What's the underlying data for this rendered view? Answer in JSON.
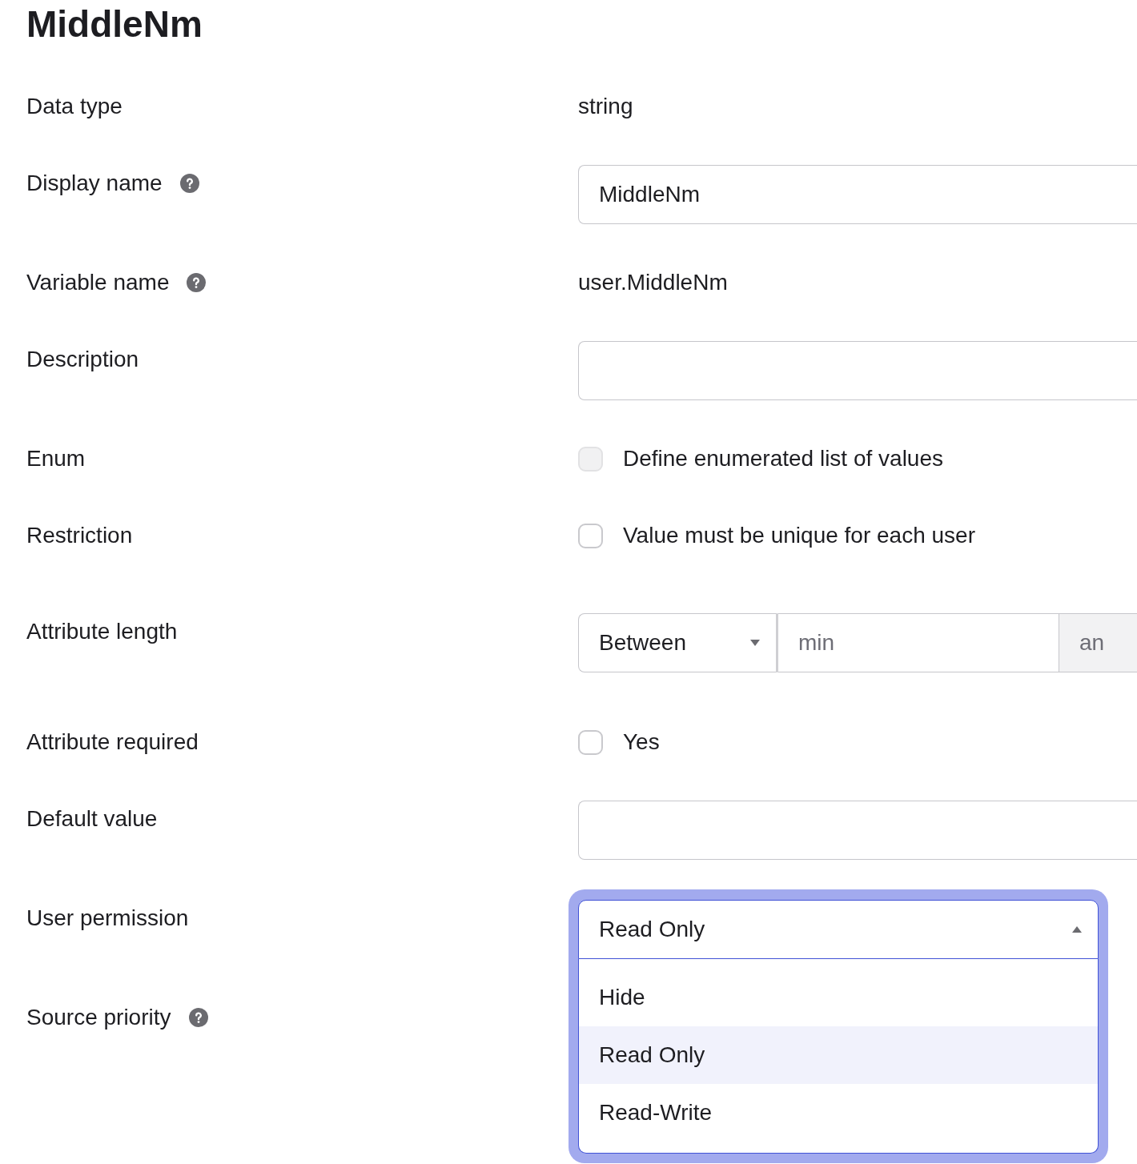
{
  "title": "MiddleNm",
  "fields": [
    {
      "kind": "text",
      "label": "Data type",
      "value": "string"
    },
    {
      "kind": "input",
      "label": "Display name",
      "help": true,
      "value": "MiddleNm"
    },
    {
      "kind": "text",
      "label": "Variable name",
      "help": true,
      "value": "user.MiddleNm"
    },
    {
      "kind": "input",
      "label": "Description"
    },
    {
      "kind": "checkbox",
      "label": "Enum",
      "checked": false,
      "disabled": true,
      "option": "Define enumerated list of values"
    },
    {
      "kind": "checkbox",
      "label": "Restriction",
      "checked": false,
      "disabled": false,
      "option": "Value must be unique for each user"
    },
    {
      "kind": "range",
      "label": "Attribute length",
      "select": {
        "value": "Between"
      },
      "min_placeholder": "min",
      "addon": "an"
    },
    {
      "kind": "checkbox",
      "label": "Attribute required",
      "checked": false,
      "disabled": false,
      "option": "Yes"
    },
    {
      "kind": "input",
      "label": "Default value"
    },
    {
      "kind": "dropdown",
      "label": "User permission",
      "value": "Read Only",
      "expanded": true,
      "options": [
        {
          "label": "Hide",
          "selected": false
        },
        {
          "label": "Read Only",
          "selected": true
        },
        {
          "label": "Read-Write",
          "selected": false
        }
      ]
    },
    {
      "kind": "covered",
      "label": "Source priority",
      "help": true
    }
  ]
}
